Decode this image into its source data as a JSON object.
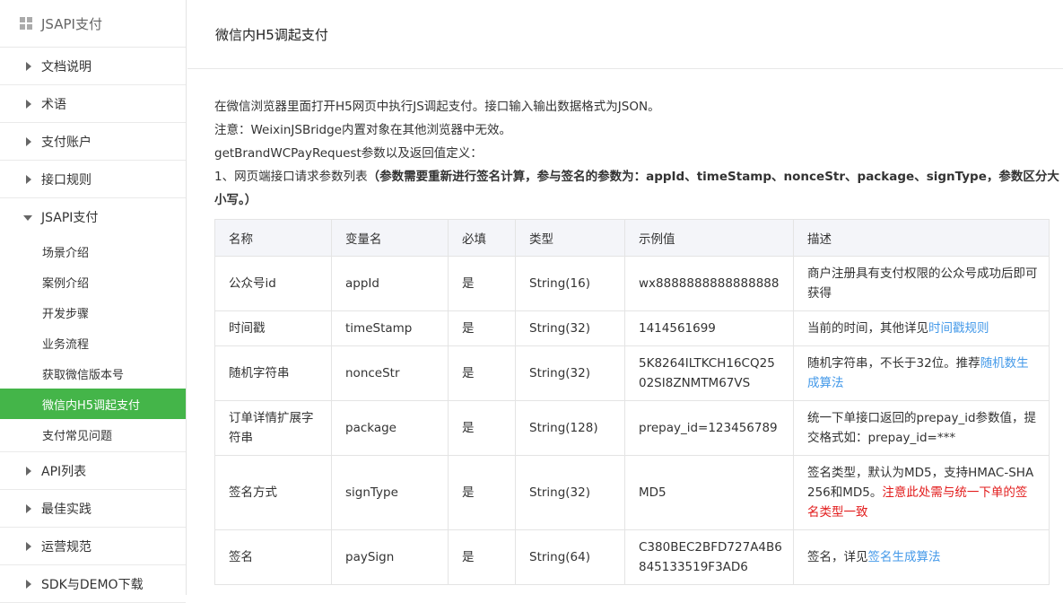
{
  "sidebar": {
    "title": "JSAPI支付",
    "items": [
      {
        "label": "文档说明"
      },
      {
        "label": "术语"
      },
      {
        "label": "支付账户"
      },
      {
        "label": "接口规则"
      },
      {
        "label": "JSAPI支付"
      }
    ],
    "subitems": [
      {
        "label": "场景介绍"
      },
      {
        "label": "案例介绍"
      },
      {
        "label": "开发步骤"
      },
      {
        "label": "业务流程"
      },
      {
        "label": "获取微信版本号"
      },
      {
        "label": "微信内H5调起支付"
      },
      {
        "label": "支付常见问题"
      }
    ],
    "items_after": [
      {
        "label": "API列表"
      },
      {
        "label": "最佳实践"
      },
      {
        "label": "运营规范"
      },
      {
        "label": "SDK与DEMO下载"
      }
    ],
    "active_color": "#44b549"
  },
  "main": {
    "title": "微信内H5调起支付",
    "intro1": "在微信浏览器里面打开H5网页中执行JS调起支付。接口输入输出数据格式为JSON。",
    "intro2": "注意：WeixinJSBridge内置对象在其他浏览器中无效。",
    "intro3": "getBrandWCPayRequest参数以及返回值定义：",
    "intro4_prefix": "1、网页端接口请求参数列表",
    "intro4_bold": "（参数需要重新进行签名计算，参与签名的参数为：appId、timeStamp、nonceStr、package、signType，参数区分大小写。）"
  },
  "table": {
    "headers": [
      "名称",
      "变量名",
      "必填",
      "类型",
      "示例值",
      "描述"
    ],
    "rows": [
      {
        "name": "公众号id",
        "var": "appId",
        "req": "是",
        "type": "String(16)",
        "example": "wx8888888888888888",
        "desc": "商户注册具有支付权限的公众号成功后即可获得"
      },
      {
        "name": "时间戳",
        "var": "timeStamp",
        "req": "是",
        "type": "String(32)",
        "example": "1414561699",
        "desc": "当前的时间，其他详见",
        "desc_link": "时间戳规则"
      },
      {
        "name": "随机字符串",
        "var": "nonceStr",
        "req": "是",
        "type": "String(32)",
        "example": "5K8264ILTKCH16CQ2502SI8ZNMTM67VS",
        "desc": "随机字符串，不长于32位。推荐",
        "desc_link": "随机数生成算法"
      },
      {
        "name": "订单详情扩展字符串",
        "var": "package",
        "req": "是",
        "type": "String(128)",
        "example": "prepay_id=123456789",
        "desc": "统一下单接口返回的prepay_id参数值，提交格式如：prepay_id=***"
      },
      {
        "name": "签名方式",
        "var": "signType",
        "req": "是",
        "type": "String(32)",
        "example": "MD5",
        "desc": "签名类型，默认为MD5，支持HMAC-SHA256和MD5。",
        "desc_red": "注意此处需与统一下单的签名类型一致"
      },
      {
        "name": "签名",
        "var": "paySign",
        "req": "是",
        "type": "String(64)",
        "example": "C380BEC2BFD727A4B6845133519F3AD6",
        "desc": "签名，详见",
        "desc_link": "签名生成算法"
      }
    ]
  },
  "icons": {
    "menu": "grid-icon",
    "collapsed": "triangle-right-icon",
    "expanded": "triangle-down-icon"
  },
  "colors": {
    "link": "#459ae9",
    "warning": "#e21c1c"
  }
}
